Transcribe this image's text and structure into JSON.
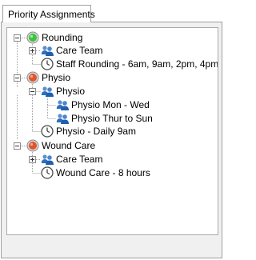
{
  "tab": {
    "label": "Priority Assignments"
  },
  "tree": {
    "nodes": [
      {
        "label": "Rounding",
        "icon": "green-status-icon",
        "color": "#3cc43c"
      },
      {
        "label": "Care Team",
        "icon": "users-icon"
      },
      {
        "label": "Staff Rounding - 6am, 9am, 2pm, 4pm",
        "icon": "clock-icon"
      },
      {
        "label": "Physio",
        "icon": "red-status-icon",
        "color": "#e0542f"
      },
      {
        "label": "Physio",
        "icon": "users-icon"
      },
      {
        "label": "Physio Mon - Wed",
        "icon": "user-icon"
      },
      {
        "label": "Physio Thur to Sun",
        "icon": "user-icon"
      },
      {
        "label": "Physio - Daily 9am",
        "icon": "clock-icon"
      },
      {
        "label": "Wound Care",
        "icon": "red-status-icon",
        "color": "#e0542f"
      },
      {
        "label": "Care Team",
        "icon": "users-icon"
      },
      {
        "label": "Wound Care - 8 hours",
        "icon": "clock-icon"
      }
    ]
  }
}
